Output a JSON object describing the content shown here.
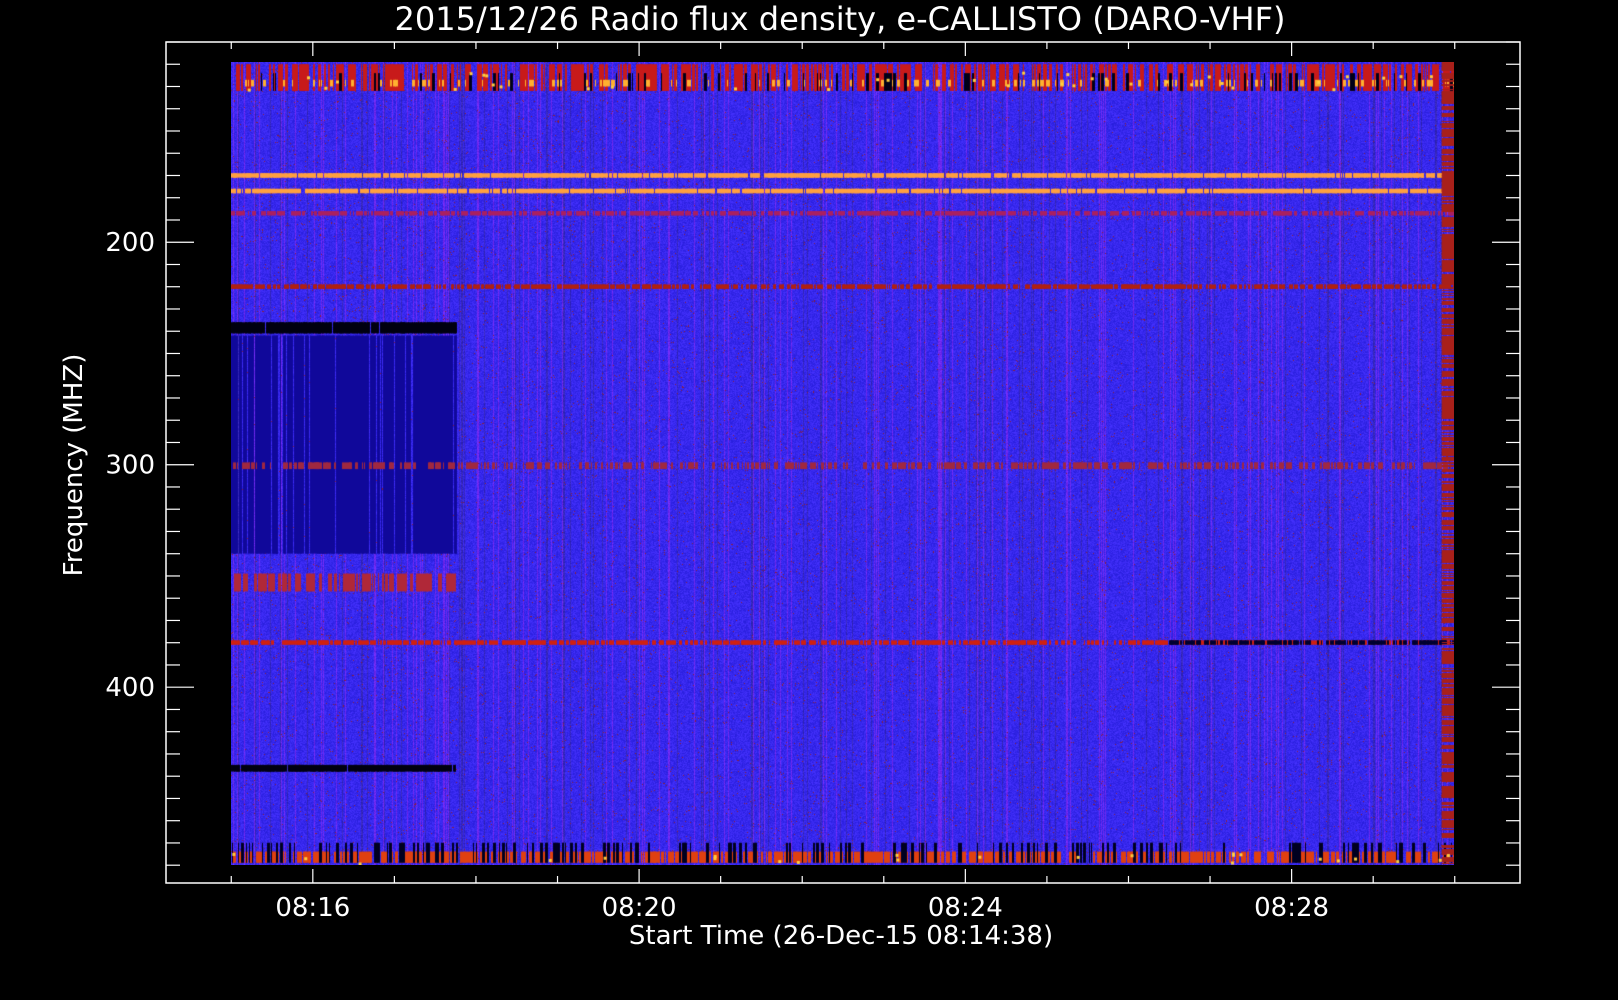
{
  "chart_data": {
    "type": "heatmap",
    "title": "2015/12/26  Radio flux density, e-CALLISTO (DARO-VHF)",
    "xlabel": "Start Time (26-Dec-15 08:14:38)",
    "ylabel": "Frequency (MHZ)",
    "x_ticks": [
      {
        "label": "08:16",
        "minute": 16
      },
      {
        "label": "08:20",
        "minute": 20
      },
      {
        "label": "08:24",
        "minute": 24
      },
      {
        "label": "08:28",
        "minute": 28
      }
    ],
    "y_ticks": [
      {
        "label": "200",
        "value": 200
      },
      {
        "label": "300",
        "value": 300
      },
      {
        "label": "400",
        "value": 400
      }
    ],
    "xlim_minutes": [
      14.2,
      30.8
    ],
    "data_x_minutes": [
      15.0,
      30.0
    ],
    "ylim_mhz": [
      110,
      488
    ],
    "data_y_mhz": [
      119,
      480
    ],
    "y_inverted": true,
    "x_minor_step_minutes": 1,
    "y_minor_step_mhz": 10,
    "colors": {
      "background": "#000000",
      "axes": "#ffffff",
      "base": "#2a28f0",
      "low": "#050028",
      "high": "#c0201a",
      "peak": "#ffd040"
    },
    "features": [
      {
        "kind": "hband",
        "f0": 120,
        "f1": 132,
        "t0": 15.0,
        "t1": 30.0,
        "color": "#c81a1a",
        "density": 0.35
      },
      {
        "kind": "hband",
        "f0": 127,
        "f1": 130,
        "t0": 15.0,
        "t1": 30.0,
        "color": "#ffb030",
        "density": 0.12
      },
      {
        "kind": "hband",
        "f0": 124,
        "f1": 132,
        "t0": 15.0,
        "t1": 30.0,
        "color": "#000018",
        "density": 0.06
      },
      {
        "kind": "hband",
        "f0": 169,
        "f1": 171,
        "t0": 15.0,
        "t1": 30.0,
        "color": "#ffa040",
        "density": 0.8
      },
      {
        "kind": "hband",
        "f0": 176,
        "f1": 178,
        "t0": 15.0,
        "t1": 30.0,
        "color": "#ffa040",
        "density": 0.8
      },
      {
        "kind": "hband",
        "f0": 186,
        "f1": 188,
        "t0": 15.0,
        "t1": 30.0,
        "color": "#aa2060",
        "density": 0.5
      },
      {
        "kind": "hband",
        "f0": 219,
        "f1": 221,
        "t0": 15.0,
        "t1": 30.0,
        "color": "#b02010",
        "density": 0.6
      },
      {
        "kind": "hband",
        "f0": 236,
        "f1": 241,
        "t0": 15.0,
        "t1": 17.75,
        "color": "#000010",
        "density": 0.95
      },
      {
        "kind": "hband",
        "f0": 242,
        "f1": 340,
        "t0": 15.0,
        "t1": 17.75,
        "color": "#10089a",
        "density": 0.6
      },
      {
        "kind": "hband",
        "f0": 299,
        "f1": 302,
        "t0": 15.0,
        "t1": 30.0,
        "color": "#a02840",
        "density": 0.35
      },
      {
        "kind": "hband",
        "f0": 379,
        "f1": 381,
        "t0": 15.0,
        "t1": 30.0,
        "color": "#d02010",
        "density": 0.55
      },
      {
        "kind": "hband",
        "f0": 379,
        "f1": 381,
        "t0": 26.5,
        "t1": 30.0,
        "color": "#000030",
        "density": 0.6
      },
      {
        "kind": "hband",
        "f0": 435,
        "f1": 438,
        "t0": 15.0,
        "t1": 17.75,
        "color": "#000010",
        "density": 0.9
      },
      {
        "kind": "hband",
        "f0": 474,
        "f1": 479,
        "t0": 15.0,
        "t1": 30.0,
        "color": "#e04010",
        "density": 0.5
      },
      {
        "kind": "hband",
        "f0": 470,
        "f1": 479,
        "t0": 15.0,
        "t1": 30.0,
        "color": "#000020",
        "density": 0.15
      },
      {
        "kind": "hband",
        "f0": 349,
        "f1": 357,
        "t0": 15.0,
        "t1": 17.75,
        "color": "#b02838",
        "density": 0.4
      },
      {
        "kind": "vband",
        "t0": 29.85,
        "t1": 30.0,
        "f0": 119,
        "f1": 480,
        "color": "#a8201a",
        "density": 0.55
      }
    ]
  }
}
